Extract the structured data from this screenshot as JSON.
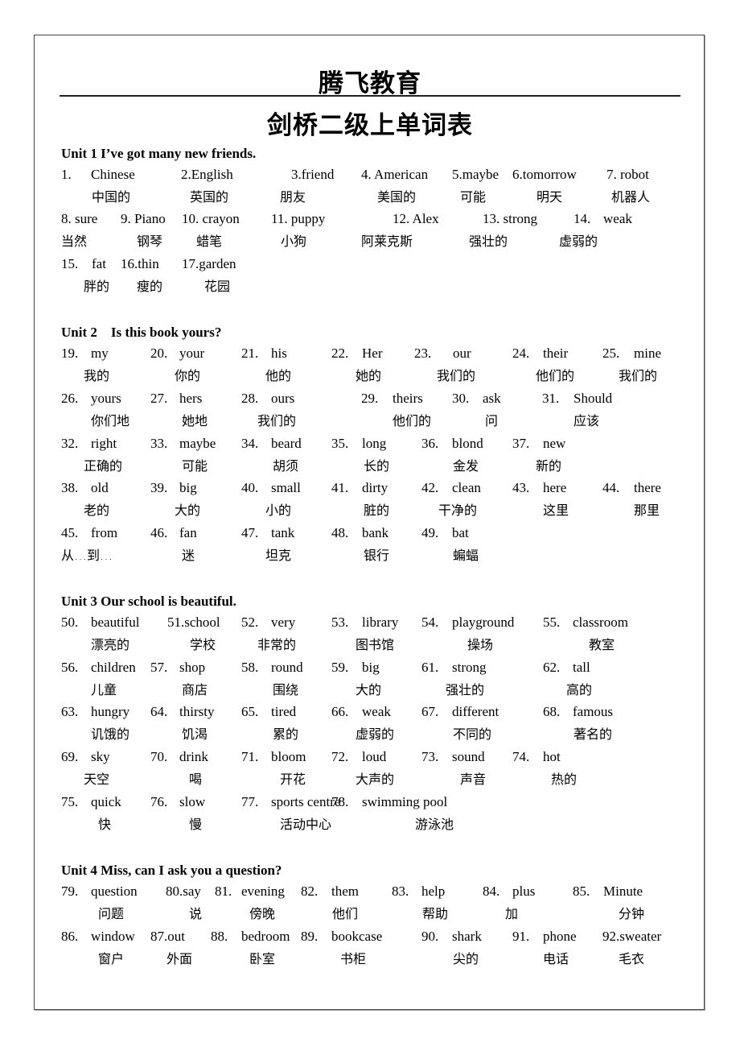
{
  "header": {
    "org": "腾飞教育",
    "title": "剑桥二级上单词表"
  },
  "units": [
    {
      "heading": "Unit 1 I’ve got many new friends.",
      "rows": [
        [
          {
            "n": "1.",
            "w": "Chinese",
            "zh": "中国的"
          },
          {
            "n": "2.",
            "w": "English",
            "zh": "英国的"
          },
          {
            "n": "3.",
            "w": "friend",
            "zh": "朋友"
          },
          {
            "n": "4.",
            "w": "American",
            "zh": "美国的"
          },
          {
            "n": "5.",
            "w": "maybe",
            "zh": "可能"
          },
          {
            "n": "6.",
            "w": "tomorrow",
            "zh": "明天"
          },
          {
            "n": "7.",
            "w": "robot",
            "zh": "机器人"
          }
        ],
        [
          {
            "n": "8.",
            "w": "sure",
            "zh": "当然"
          },
          {
            "n": "9.",
            "w": "Piano",
            "zh": "钢琴"
          },
          {
            "n": "10.",
            "w": "crayon",
            "zh": "蜡笔"
          },
          {
            "n": "11.",
            "w": "puppy",
            "zh": "小狗"
          },
          {
            "n": "12.",
            "w": "Alex",
            "zh": "阿莱克斯"
          },
          {
            "n": "13.",
            "w": "strong",
            "zh": "强壮的"
          },
          {
            "n": "14.",
            "w": "weak",
            "zh": "虚弱的"
          }
        ],
        [
          {
            "n": "15.",
            "w": "fat",
            "zh": "胖的"
          },
          {
            "n": "16.",
            "w": "thin",
            "zh": "瘦的"
          },
          {
            "n": "17.",
            "w": "garden",
            "zh": "花园"
          }
        ]
      ]
    },
    {
      "heading": "Unit 2    Is this book yours?",
      "rows": [
        [
          {
            "n": "19.",
            "w": "my",
            "zh": "我的"
          },
          {
            "n": "20.",
            "w": "your",
            "zh": "你的"
          },
          {
            "n": "21.",
            "w": "his",
            "zh": "他的"
          },
          {
            "n": "22.",
            "w": "Her",
            "zh": "她的"
          },
          {
            "n": "23.",
            "w": "our",
            "zh": "我们的"
          },
          {
            "n": "24.",
            "w": "their",
            "zh": "他们的"
          },
          {
            "n": "25.",
            "w": "mine",
            "zh": "我们的"
          }
        ],
        [
          {
            "n": "26.",
            "w": "yours",
            "zh": "你们地"
          },
          {
            "n": "27.",
            "w": "hers",
            "zh": "她地"
          },
          {
            "n": "28.",
            "w": "ours",
            "zh": "我们的"
          },
          {
            "n": "29.",
            "w": "theirs",
            "zh": "他们的"
          },
          {
            "n": "30.",
            "w": "ask",
            "zh": "问"
          },
          {
            "n": "31.",
            "w": "Should",
            "zh": "应该"
          }
        ],
        [
          {
            "n": "32.",
            "w": "right",
            "zh": "正确的"
          },
          {
            "n": "33.",
            "w": "maybe",
            "zh": "可能"
          },
          {
            "n": "34.",
            "w": "beard",
            "zh": "胡须"
          },
          {
            "n": "35.",
            "w": "long",
            "zh": "长的"
          },
          {
            "n": "36.",
            "w": "blond",
            "zh": "金发"
          },
          {
            "n": "37.",
            "w": "new",
            "zh": "新的"
          }
        ],
        [
          {
            "n": "38.",
            "w": "old",
            "zh": "老的"
          },
          {
            "n": "39.",
            "w": "big",
            "zh": "大的"
          },
          {
            "n": "40.",
            "w": "small",
            "zh": "小的"
          },
          {
            "n": "41.",
            "w": "dirty",
            "zh": "脏的"
          },
          {
            "n": "42.",
            "w": "clean",
            "zh": "干净的"
          },
          {
            "n": "43.",
            "w": "here",
            "zh": "这里"
          },
          {
            "n": "44.",
            "w": "there",
            "zh": "那里"
          }
        ],
        [
          {
            "n": "45.",
            "w": "from",
            "zh": "从…到…"
          },
          {
            "n": "46.",
            "w": "fan",
            "zh": "迷"
          },
          {
            "n": "47.",
            "w": "tank",
            "zh": "坦克"
          },
          {
            "n": "48.",
            "w": "bank",
            "zh": "银行"
          },
          {
            "n": "49.",
            "w": "bat",
            "zh": "蝙蝠"
          }
        ]
      ]
    },
    {
      "heading": "Unit 3 Our school is beautiful.",
      "rows": [
        [
          {
            "n": "50.",
            "w": "beautiful",
            "zh": "漂亮的"
          },
          {
            "n": "51.",
            "w": "school",
            "zh": "学校"
          },
          {
            "n": "52.",
            "w": "very",
            "zh": "非常的"
          },
          {
            "n": "53.",
            "w": "library",
            "zh": "图书馆"
          },
          {
            "n": "54.",
            "w": "playground",
            "zh": "操场"
          },
          {
            "n": "55.",
            "w": "classroom",
            "zh": "教室"
          }
        ],
        [
          {
            "n": "56.",
            "w": "children",
            "zh": "儿童"
          },
          {
            "n": "57.",
            "w": "shop",
            "zh": "商店"
          },
          {
            "n": "58.",
            "w": "round",
            "zh": "围绕"
          },
          {
            "n": "59.",
            "w": "big",
            "zh": "大的"
          },
          {
            "n": "61.",
            "w": "strong",
            "zh": "强壮的"
          },
          {
            "n": "62.",
            "w": "tall",
            "zh": "高的"
          }
        ],
        [
          {
            "n": "63.",
            "w": "hungry",
            "zh": "讥饿的"
          },
          {
            "n": "64.",
            "w": "thirsty",
            "zh": "饥渴"
          },
          {
            "n": "65.",
            "w": "tired",
            "zh": "累的"
          },
          {
            "n": "66.",
            "w": "weak",
            "zh": "虚弱的"
          },
          {
            "n": "67.",
            "w": "different",
            "zh": "不同的"
          },
          {
            "n": "68.",
            "w": "famous",
            "zh": "著名的"
          }
        ],
        [
          {
            "n": "69.",
            "w": "sky",
            "zh": "天空"
          },
          {
            "n": "70.",
            "w": "drink",
            "zh": "喝"
          },
          {
            "n": "71.",
            "w": "bloom",
            "zh": "开花"
          },
          {
            "n": "72.",
            "w": "loud",
            "zh": "大声的"
          },
          {
            "n": "73.",
            "w": "sound",
            "zh": "声音"
          },
          {
            "n": "74.",
            "w": "hot",
            "zh": "热的"
          }
        ],
        [
          {
            "n": "75.",
            "w": "quick",
            "zh": "快"
          },
          {
            "n": "76.",
            "w": "slow",
            "zh": "慢"
          },
          {
            "n": "77.",
            "w": "sports centre",
            "zh": "活动中心"
          },
          {
            "n": "78.",
            "w": "swimming pool",
            "zh": "游泳池"
          }
        ]
      ]
    },
    {
      "heading": "Unit 4 Miss, can I ask you a question?",
      "rows": [
        [
          {
            "n": "79.",
            "w": "question",
            "zh": "问题"
          },
          {
            "n": "80.",
            "w": "say",
            "zh": "说"
          },
          {
            "n": "81.",
            "w": "evening",
            "zh": "傍晚"
          },
          {
            "n": "82.",
            "w": "them",
            "zh": "他们"
          },
          {
            "n": "83.",
            "w": "help",
            "zh": "帮助"
          },
          {
            "n": "84.",
            "w": "plus",
            "zh": "加"
          },
          {
            "n": "85.",
            "w": "Minute",
            "zh": "分钟"
          }
        ],
        [
          {
            "n": "86.",
            "w": "window",
            "zh": "窗户"
          },
          {
            "n": "87.",
            "w": "out",
            "zh": "外面"
          },
          {
            "n": "88.",
            "w": "bedroom",
            "zh": "卧室"
          },
          {
            "n": "89.",
            "w": "bookcase",
            "zh": "书柜"
          },
          {
            "n": "90.",
            "w": "shark",
            "zh": "尖的"
          },
          {
            "n": "91.",
            "w": "phone",
            "zh": "电话"
          },
          {
            "n": "92.",
            "w": "sweater",
            "zh": "毛衣"
          }
        ]
      ]
    }
  ]
}
